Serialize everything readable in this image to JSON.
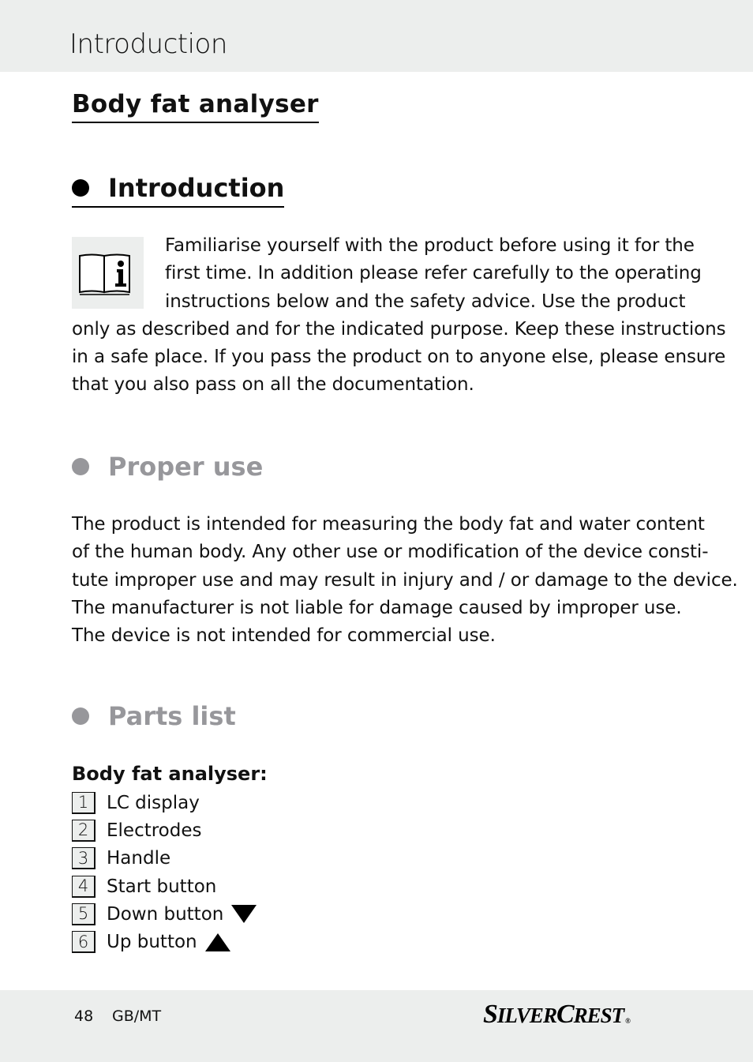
{
  "header": {
    "title": "Introduction"
  },
  "document": {
    "title": "Body fat analyser",
    "sections": [
      {
        "heading": "Introduction",
        "active": true,
        "icon": "book-info-icon",
        "lines": [
          "Familiarise yourself with the product before using it for the",
          "first time. In addition please refer carefully to the operating",
          "instructions below and the safety advice. Use the product",
          "only as described and for the indicated purpose. Keep these instructions",
          "in a safe place. If you pass the product on to anyone else, please ensure",
          "that you also pass on all the documentation."
        ]
      },
      {
        "heading": "Proper use",
        "active": false,
        "lines": [
          "The product is intended for measuring the body fat and water content",
          "of the human body. Any other use or modification of the device consti-",
          "tute improper use and may result in injury and / or damage to the device.",
          "The manufacturer is not liable for damage caused by improper use.",
          "The device is not intended for commercial use."
        ]
      },
      {
        "heading": "Parts list",
        "active": false,
        "subheading": "Body fat analyser:",
        "parts": [
          {
            "num": "1",
            "label": "LC display",
            "icon": ""
          },
          {
            "num": "2",
            "label": "Electrodes",
            "icon": ""
          },
          {
            "num": "3",
            "label": "Handle",
            "icon": ""
          },
          {
            "num": "4",
            "label": "Start button",
            "icon": ""
          },
          {
            "num": "5",
            "label": "Down button",
            "icon": "triangle-down-icon"
          },
          {
            "num": "6",
            "label": "Up button",
            "icon": "triangle-up-icon"
          }
        ]
      }
    ]
  },
  "footer": {
    "page_number": "48",
    "locale": "GB/MT",
    "brand_first": "S",
    "brand_first_rest": "ILVER",
    "brand_second": "C",
    "brand_second_rest": "REST",
    "brand_mark": "®"
  },
  "colors": {
    "band_background": "#eceeed",
    "muted_heading": "#97979b",
    "text": "#111111"
  }
}
